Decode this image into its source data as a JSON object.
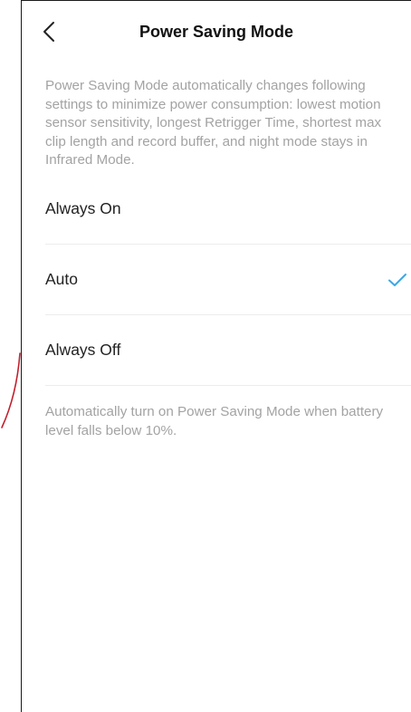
{
  "header": {
    "title": "Power Saving Mode",
    "back_icon": "chevron-left-icon"
  },
  "description": "Power Saving Mode automatically changes following settings to minimize power consumption: lowest motion sensor sensitivity, longest Retrigger Time, shortest max clip length and record buffer, and night mode stays in Infrared Mode.",
  "options": [
    {
      "label": "Always On",
      "selected": false
    },
    {
      "label": "Auto",
      "selected": true
    },
    {
      "label": "Always Off",
      "selected": false
    }
  ],
  "check_icon": "checkmark-icon",
  "footer_note": "Automatically turn on Power Saving Mode when battery level falls below 10%.",
  "colors": {
    "accent": "#3aa7e8",
    "secondary_text": "#a3a3a3",
    "divider": "#ececec",
    "annotation": "#c21e2b"
  }
}
